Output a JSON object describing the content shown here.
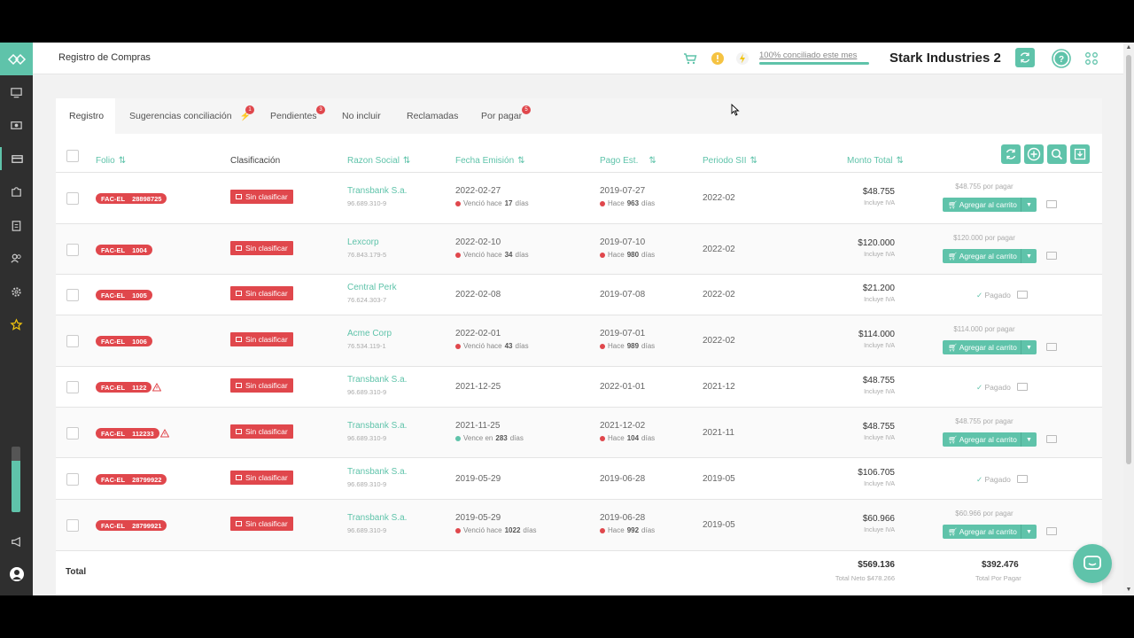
{
  "header": {
    "page_title": "Registro de Compras",
    "conciliado": "100% conciliado este mes",
    "company": "Stark Industries 2"
  },
  "sidebar": {
    "icons": [
      "monitor-icon",
      "money-icon",
      "credit-card-icon",
      "puzzle-icon",
      "clipboard-icon",
      "users-icon",
      "settings-icon",
      "star-icon"
    ],
    "bottom_icons": [
      "megaphone-icon",
      "user-avatar-icon"
    ],
    "progress_fraction": 0.78
  },
  "tabs": [
    {
      "label": "Registro",
      "badge": ""
    },
    {
      "label": "Sugerencias conciliación",
      "badge": "1"
    },
    {
      "label": "Pendientes",
      "badge": "3"
    },
    {
      "label": "No incluir",
      "badge": ""
    },
    {
      "label": "Reclamadas",
      "badge": ""
    },
    {
      "label": "Por pagar",
      "badge": "5"
    }
  ],
  "columns": {
    "folio": "Folio",
    "clasificacion": "Clasificación",
    "razon": "Razon Social",
    "fecha": "Fecha Emisión",
    "pago": "Pago Est.",
    "periodo": "Periodo SII",
    "monto": "Monto Total"
  },
  "labels": {
    "sin_clasificar": "Sin clasificar",
    "incluye_iva": "Incluye IVA",
    "agregar": "Agregar al carrito",
    "pagado": "Pagado",
    "por_pagar_suffix": "por pagar"
  },
  "rows": [
    {
      "folio_type": "FAC-EL",
      "folio": "28898725",
      "razon": "Transbank S.a.",
      "rut": "96.689.310-9",
      "fecha": "2022-02-27",
      "fecha_sub_pre": "Venció hace",
      "fecha_sub_num": "17",
      "fecha_sub_post": "días",
      "pago": "2019-07-27",
      "pago_sub_pre": "Hace",
      "pago_sub_num": "963",
      "pago_sub_post": "días",
      "periodo": "2022-02",
      "monto": "$48.755",
      "por_pagar": "$48.755",
      "status": "cart"
    },
    {
      "folio_type": "FAC-EL",
      "folio": "1004",
      "razon": "Lexcorp",
      "rut": "76.843.179-5",
      "fecha": "2022-02-10",
      "fecha_sub_pre": "Venció hace",
      "fecha_sub_num": "34",
      "fecha_sub_post": "días",
      "pago": "2019-07-10",
      "pago_sub_pre": "Hace",
      "pago_sub_num": "980",
      "pago_sub_post": "días",
      "periodo": "2022-02",
      "monto": "$120.000",
      "por_pagar": "$120.000",
      "status": "cart"
    },
    {
      "folio_type": "FAC-EL",
      "folio": "1005",
      "razon": "Central Perk",
      "rut": "76.624.303-7",
      "fecha": "2022-02-08",
      "pago": "2019-07-08",
      "periodo": "2022-02",
      "monto": "$21.200",
      "status": "paid"
    },
    {
      "folio_type": "FAC-EL",
      "folio": "1006",
      "razon": "Acme Corp",
      "rut": "76.534.119-1",
      "fecha": "2022-02-01",
      "fecha_sub_pre": "Venció hace",
      "fecha_sub_num": "43",
      "fecha_sub_post": "días",
      "pago": "2019-07-01",
      "pago_sub_pre": "Hace",
      "pago_sub_num": "989",
      "pago_sub_post": "días",
      "periodo": "2022-02",
      "monto": "$114.000",
      "por_pagar": "$114.000",
      "status": "cart"
    },
    {
      "folio_type": "FAC-EL",
      "folio": "1122",
      "razon": "Transbank S.a.",
      "rut": "96.689.310-9",
      "fecha": "2021-12-25",
      "pago": "2022-01-01",
      "periodo": "2021-12",
      "monto": "$48.755",
      "status": "paid",
      "warn": true
    },
    {
      "folio_type": "FAC-EL",
      "folio": "112233",
      "razon": "Transbank S.a.",
      "rut": "96.689.310-9",
      "fecha": "2021-11-25",
      "fecha_sub_pre": "Vence en",
      "fecha_sub_num": "283",
      "fecha_sub_post": "días",
      "fecha_sub_green": true,
      "pago": "2021-12-02",
      "pago_sub_pre": "Hace",
      "pago_sub_num": "104",
      "pago_sub_post": "días",
      "periodo": "2021-11",
      "monto": "$48.755",
      "por_pagar": "$48.755",
      "status": "cart",
      "warn": true
    },
    {
      "folio_type": "FAC-EL",
      "folio": "28799922",
      "razon": "Transbank S.a.",
      "rut": "96.689.310-9",
      "fecha": "2019-05-29",
      "pago": "2019-06-28",
      "periodo": "2019-05",
      "monto": "$106.705",
      "status": "paid"
    },
    {
      "folio_type": "FAC-EL",
      "folio": "28799921",
      "razon": "Transbank S.a.",
      "rut": "96.689.310-9",
      "fecha": "2019-05-29",
      "fecha_sub_pre": "Venció hace",
      "fecha_sub_num": "1022",
      "fecha_sub_post": "días",
      "pago": "2019-06-28",
      "pago_sub_pre": "Hace",
      "pago_sub_num": "992",
      "pago_sub_post": "días",
      "periodo": "2019-05",
      "monto": "$60.966",
      "por_pagar": "$60.966",
      "status": "cart"
    }
  ],
  "totals": {
    "label": "Total",
    "monto": "$569.136",
    "neto": "Total Neto $478.266",
    "por_pagar": "$392.476",
    "por_pagar_label": "Total Por Pagar"
  },
  "colors": {
    "accent": "#5fc3aa",
    "danger": "#e0474c",
    "sidebar": "#2f2f2f"
  }
}
